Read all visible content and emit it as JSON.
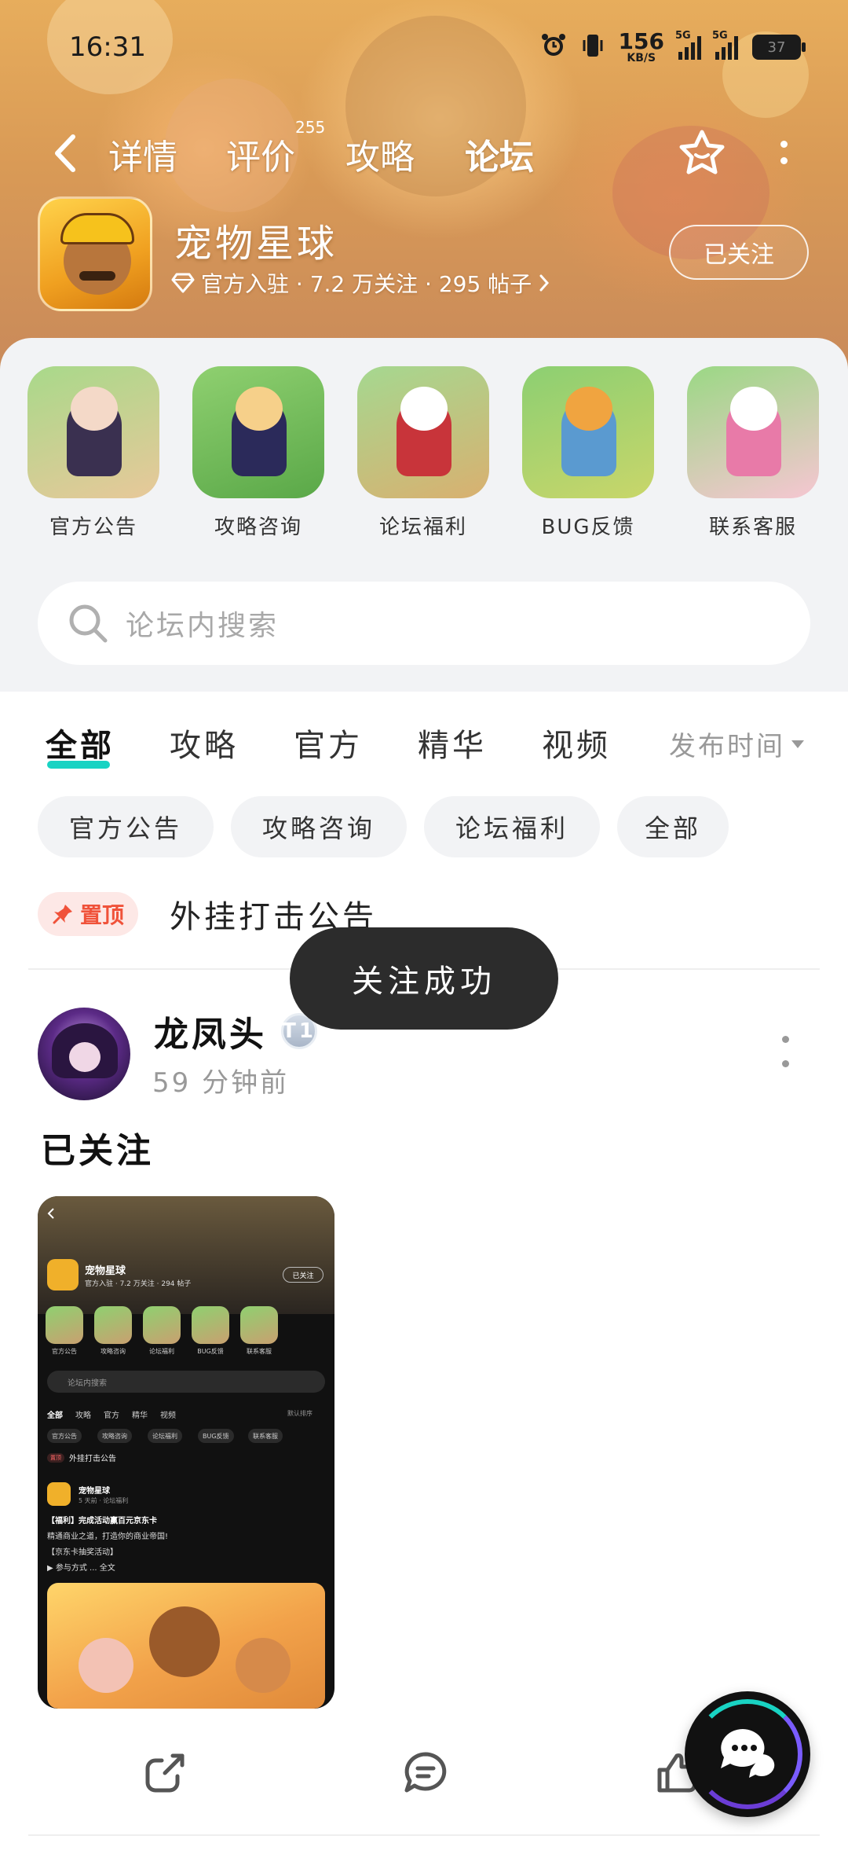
{
  "status_bar": {
    "time": "16:31",
    "net_speed": "156",
    "net_unit": "KB/S",
    "signal1_tag": "5G",
    "signal2_tag": "5G",
    "battery": "37"
  },
  "nav": {
    "tabs": [
      "详情",
      "评价",
      "攻略",
      "论坛"
    ],
    "active_tab": "论坛",
    "review_count": "255"
  },
  "game": {
    "title": "宠物星球",
    "meta": "官方入驻 · 7.2 万关注 · 295 帖子",
    "follow_label": "已关注"
  },
  "quick_links": [
    {
      "label": "官方公告"
    },
    {
      "label": "攻略咨询"
    },
    {
      "label": "论坛福利"
    },
    {
      "label": "BUG反馈"
    },
    {
      "label": "联系客服"
    }
  ],
  "search": {
    "placeholder": "论坛内搜索"
  },
  "filter_tabs": [
    "全部",
    "攻略",
    "官方",
    "精华",
    "视频"
  ],
  "sort_label": "发布时间",
  "chips": [
    "官方公告",
    "攻略咨询",
    "论坛福利",
    "全部"
  ],
  "pinned": {
    "badge": "置顶",
    "title": "外挂打击公告"
  },
  "toast": "关注成功",
  "post": {
    "user": "龙凤头",
    "user_badge": "T1",
    "time": "59 分钟前",
    "text": "已关注",
    "image": {
      "title": "宠物星球",
      "meta": "官方入驻 · 7.2 万关注 · 294 帖子",
      "follow": "已关注",
      "quick_labels": [
        "官方公告",
        "攻略咨询",
        "论坛福利",
        "BUG反馈",
        "联系客服"
      ],
      "search": "论坛内搜索",
      "tabs": [
        "全部",
        "攻略",
        "官方",
        "精华",
        "视频"
      ],
      "sort": "默认排序",
      "chips": [
        "官方公告",
        "攻略咨询",
        "论坛福利",
        "BUG反馈",
        "联系客服"
      ],
      "pin_badge": "置顶",
      "pin_title": "外挂打击公告",
      "post_name": "宠物星球",
      "post_sub": "5 天前 · 论坛福利",
      "line1": "【福利】完成活动赢百元京东卡",
      "line2": "精通商业之道，打造你的商业帝国!",
      "line3": "【京东卡抽奖活动】",
      "line4": "▶ 参与方式 ... 全文"
    }
  }
}
